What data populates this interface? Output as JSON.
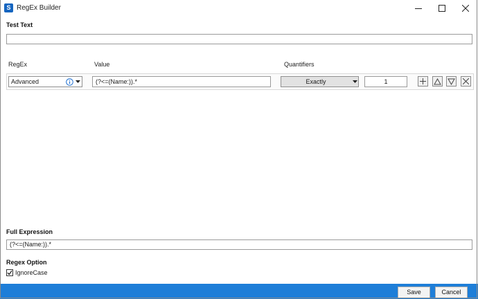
{
  "window": {
    "title": "RegEx Builder",
    "icon_text": "S"
  },
  "test_text": {
    "label": "Test Text",
    "value": ""
  },
  "headers": {
    "regex": "RegEx",
    "value": "Value",
    "quantifiers": "Quantifiers"
  },
  "row": {
    "regex_type": "Advanced",
    "value": "(?<=(Name:)).*",
    "quantifier": "Exactly",
    "count": "1"
  },
  "full_expression": {
    "label": "Full Expression",
    "value": "(?<=(Name:)).*"
  },
  "regex_option": {
    "label": "Regex Option",
    "ignore_case_label": "IgnoreCase",
    "ignore_case_checked": true
  },
  "buttons": {
    "save": "Save",
    "cancel": "Cancel"
  },
  "colors": {
    "footer": "#1e7ed8",
    "info_icon": "#1f6fd1",
    "app_icon": "#1565c0"
  }
}
